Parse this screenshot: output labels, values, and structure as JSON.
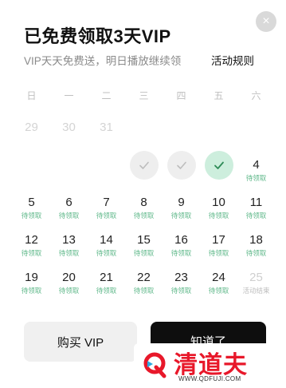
{
  "dialog": {
    "title": "已免费领取3天VIP",
    "subtitle": "VIP天天免费送，明日播放继续领",
    "rules_link": "活动规则",
    "close_icon": "×"
  },
  "weekdays": [
    "日",
    "一",
    "二",
    "三",
    "四",
    "五",
    "六"
  ],
  "calendar": {
    "row1": [
      "29",
      "30",
      "31"
    ],
    "row2": {
      "sat_day": "4",
      "sat_tag": "待领取",
      "checked_days": 3
    },
    "row3": [
      {
        "day": "5",
        "tag": "待领取"
      },
      {
        "day": "6",
        "tag": "待领取"
      },
      {
        "day": "7",
        "tag": "待领取"
      },
      {
        "day": "8",
        "tag": "待领取"
      },
      {
        "day": "9",
        "tag": "待领取"
      },
      {
        "day": "10",
        "tag": "待领取"
      },
      {
        "day": "11",
        "tag": "待领取"
      }
    ],
    "row4": [
      {
        "day": "12",
        "tag": "待领取"
      },
      {
        "day": "13",
        "tag": "待领取"
      },
      {
        "day": "14",
        "tag": "待领取"
      },
      {
        "day": "15",
        "tag": "待领取"
      },
      {
        "day": "16",
        "tag": "待领取"
      },
      {
        "day": "17",
        "tag": "待领取"
      },
      {
        "day": "18",
        "tag": "待领取"
      }
    ],
    "row5": [
      {
        "day": "19",
        "tag": "待领取"
      },
      {
        "day": "20",
        "tag": "待领取"
      },
      {
        "day": "21",
        "tag": "待领取"
      },
      {
        "day": "22",
        "tag": "待领取"
      },
      {
        "day": "23",
        "tag": "待领取"
      },
      {
        "day": "24",
        "tag": "待领取"
      },
      {
        "day": "25",
        "tag": "活动结束"
      }
    ]
  },
  "buttons": {
    "buy": "购买 VIP",
    "ok": "知道了"
  },
  "watermark": {
    "brand": "清道夫",
    "url": "WWW.QDFUJI.COM"
  },
  "colors": {
    "accent_green": "#5fb88a",
    "check_today_bg": "#cdeedd",
    "brand_red": "#e8182a"
  }
}
